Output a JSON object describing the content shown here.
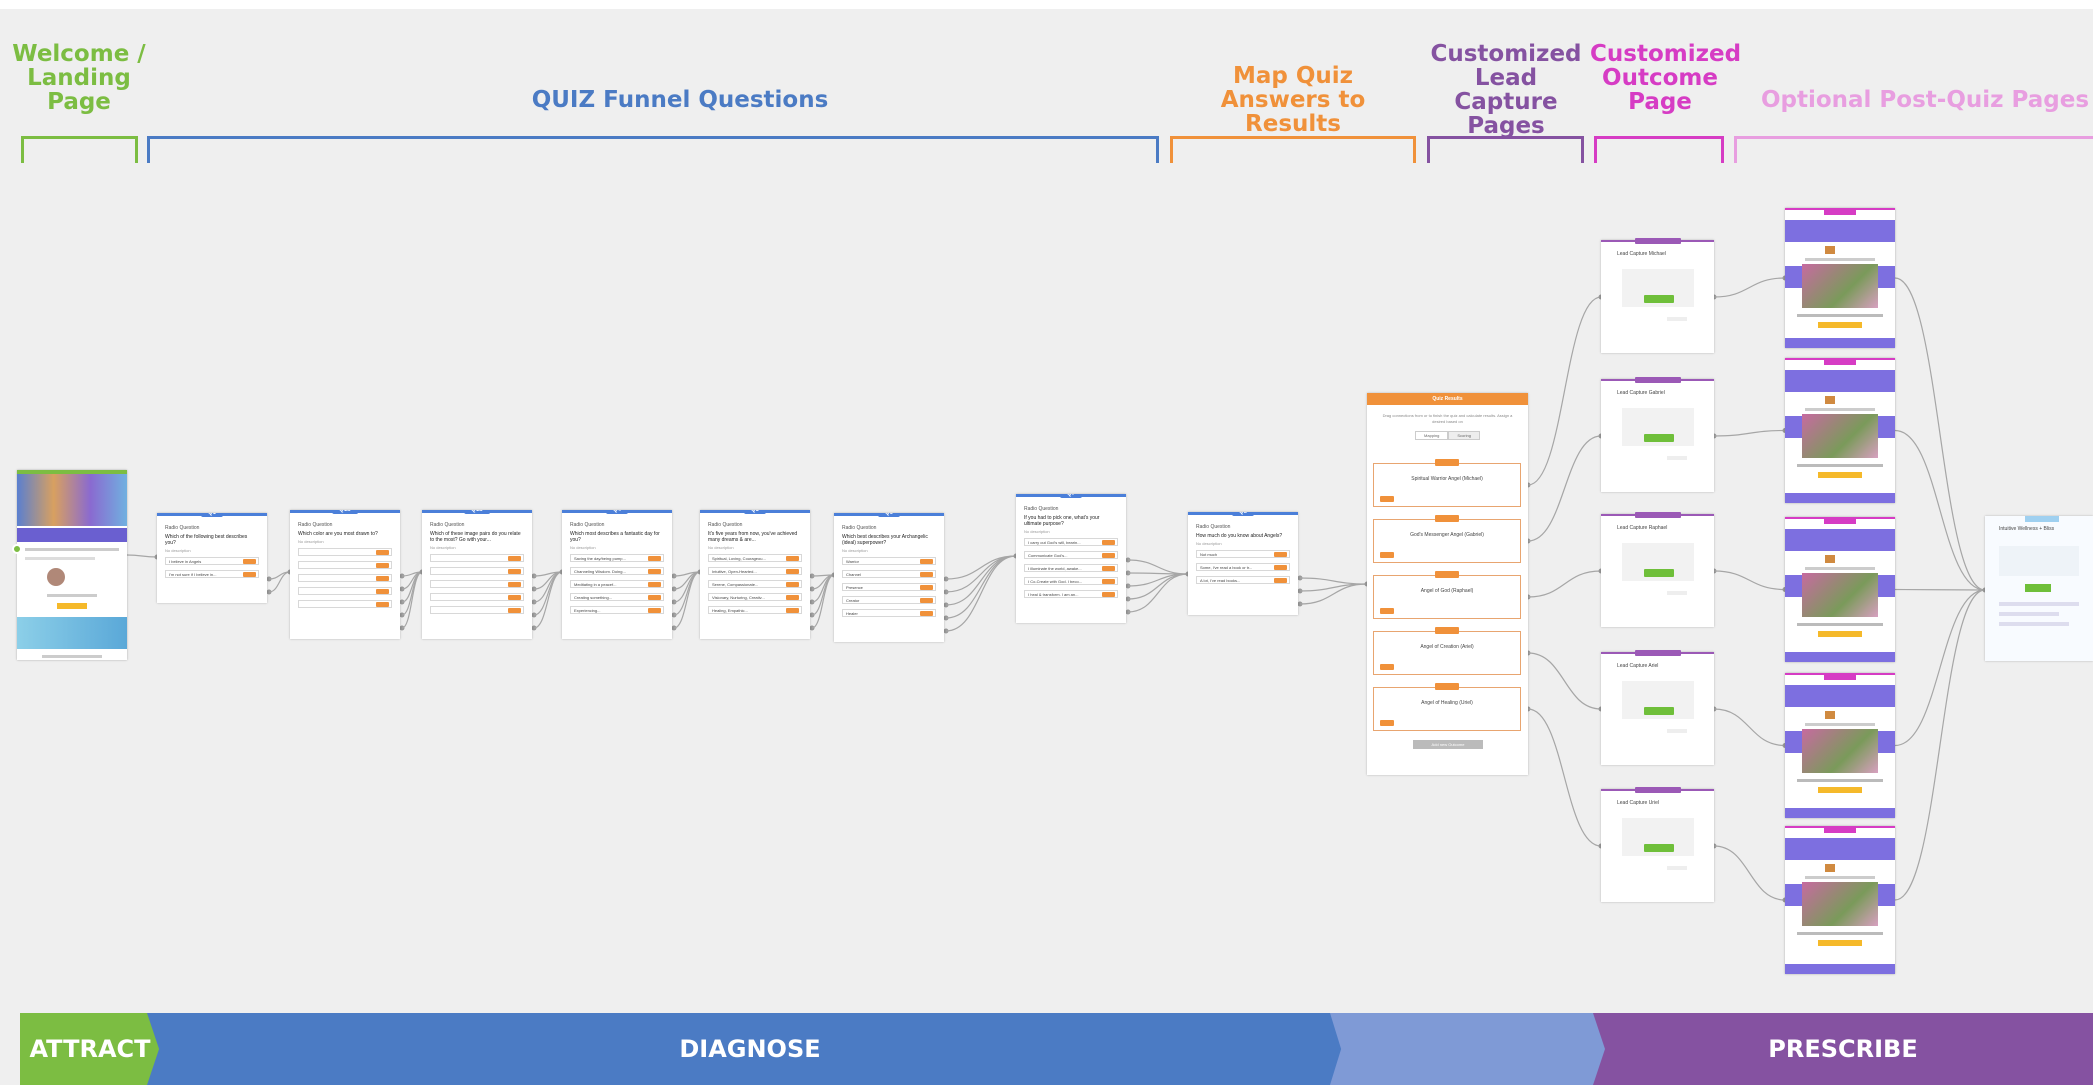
{
  "phases": [
    {
      "label": "Welcome / Landing Page",
      "color": "#7cbd42"
    },
    {
      "label": "QUIZ Funnel Questions",
      "color": "#4b7bc4"
    },
    {
      "label": "Map Quiz Answers to Results",
      "color": "#f0913a"
    },
    {
      "label": "Customized Lead Capture Pages",
      "color": "#8552a1"
    },
    {
      "label": "Customized Outcome Page",
      "color": "#d63cc4"
    },
    {
      "label": "Optional Post-Quiz Pages",
      "color": "#e89ee0"
    }
  ],
  "stages": [
    {
      "label": "ATTRACT",
      "color": "#7cbd42"
    },
    {
      "label": "DIAGNOSE",
      "color": "#4b7bc4"
    },
    {
      "label": "",
      "color": "#7f9ad6"
    },
    {
      "label": "PRESCRIBE",
      "color": "#8552a1"
    }
  ],
  "questions": [
    {
      "tag": "Q1",
      "type": "Radio Question",
      "text": "Which of the following best describes you?",
      "desc": "No description",
      "options": [
        "I believe in Angels",
        "I'm not sure if I believe in..."
      ]
    },
    {
      "tag": "Q1b",
      "type": "Radio Question",
      "text": "Which color are you most drawn to?",
      "desc": "No description",
      "options": [
        "",
        "",
        "",
        "",
        ""
      ]
    },
    {
      "tag": "Q1b",
      "type": "Radio Question",
      "text": "Which of these image pairs do you relate to the most? Go with your...",
      "desc": "No description",
      "options": [
        "",
        "",
        "",
        "",
        ""
      ]
    },
    {
      "tag": "Q4",
      "type": "Radio Question",
      "text": "Which most describes a fantastic day for you?",
      "desc": "No description",
      "options": [
        "Saving the day/being pump...",
        "Channeling Wisdom. Doing...",
        "Meditating in a peacef...",
        "Creating something...",
        "Experiencing..."
      ]
    },
    {
      "tag": "Q5",
      "type": "Radio Question",
      "text": "It's five years from now, you've achieved many dreams & are...",
      "desc": "No description",
      "options": [
        "Spiritual, Loving, Courageou...",
        "Intuitive, Open-Hearted...",
        "Serene, Compassionate...",
        "Visionary, Nurturing, Creativ...",
        "Healing, Empathic..."
      ]
    },
    {
      "tag": "Q6",
      "type": "Radio Question",
      "text": "Which best describes your Archangelic (ideal) superpower?",
      "desc": "No description",
      "options": [
        "Warrior",
        "Channel",
        "Presence",
        "Creator",
        "Healer"
      ]
    },
    {
      "tag": "Q7",
      "type": "Radio Question",
      "text": "If you had to pick one, what's your ultimate purpose?",
      "desc": "No description",
      "options": [
        "I carry out God's will, bearin...",
        "Communicate God's...",
        "I illuminate the world, awake...",
        "I Co-Create with God. I beco...",
        "I heal & transform. I am an..."
      ]
    },
    {
      "tag": "Q8",
      "type": "Radio Question",
      "text": "How much do you know about Angels?",
      "desc": "No description",
      "options": [
        "Not much",
        "Some, I've read a book or tr...",
        "A lot, I've read books..."
      ]
    }
  ],
  "map_results": {
    "header": "Quiz Results",
    "desc": "Drag connections from or to finish the quiz and calculate results. Assign a desired based on",
    "tabs": [
      "Mapping",
      "Scoring"
    ],
    "results": [
      "Spiritual Warrior Angel (Michael)",
      "God's Messenger Angel (Gabriel)",
      "Angel of God (Raphael)",
      "Angel of Creation (Ariel)",
      "Angel of Healing (Uriel)"
    ],
    "add_button": "Add new Outcome"
  },
  "lead_captures": [
    {
      "tag": "Quiz Capture 1",
      "name": "Lead Capture Michael",
      "button": "Get"
    },
    {
      "tag": "Quiz Capture 2",
      "name": "Lead Capture Gabriel",
      "button": "Get"
    },
    {
      "tag": "Quiz Capture 3",
      "name": "Lead Capture Raphael",
      "button": "Free"
    },
    {
      "tag": "Quiz Capture 4",
      "name": "Lead Capture Ariel",
      "button": "Get"
    },
    {
      "tag": "Quiz Capture 5",
      "name": "Lead Capture Uriel",
      "button": "Get"
    }
  ],
  "outcomes": [
    {
      "tag": "Outcome 1"
    },
    {
      "tag": "Outcome 2"
    },
    {
      "tag": "Outcome 3"
    },
    {
      "tag": "Outcome 4"
    },
    {
      "tag": "Outcome 5"
    }
  ],
  "post_quiz": {
    "tag": "Sales Page 1",
    "name": "Intuitive Wellness + Bliss"
  }
}
